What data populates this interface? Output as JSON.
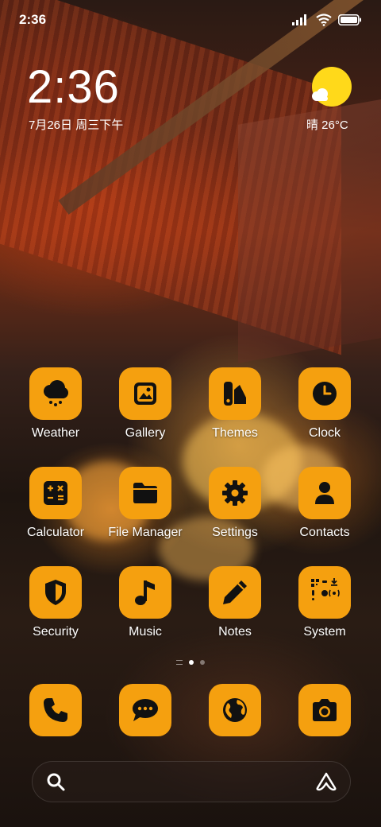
{
  "status_bar": {
    "time": "2:36"
  },
  "clock_widget": {
    "time": "2:36",
    "date": "7月26日 周三下午"
  },
  "weather_widget": {
    "text": "晴 26°C"
  },
  "apps": [
    {
      "label": "Weather",
      "icon": "cloud-rain-icon"
    },
    {
      "label": "Gallery",
      "icon": "image-icon"
    },
    {
      "label": "Themes",
      "icon": "theme-palette-icon"
    },
    {
      "label": "Clock",
      "icon": "clock-icon"
    },
    {
      "label": "Calculator",
      "icon": "calculator-icon"
    },
    {
      "label": "File Manager",
      "icon": "folder-icon"
    },
    {
      "label": "Settings",
      "icon": "gear-icon"
    },
    {
      "label": "Contacts",
      "icon": "person-icon"
    },
    {
      "label": "Security",
      "icon": "shield-icon"
    },
    {
      "label": "Music",
      "icon": "music-note-icon"
    },
    {
      "label": "Notes",
      "icon": "pencil-icon"
    },
    {
      "label": "System",
      "icon": "tools-grid-icon"
    }
  ],
  "dock": [
    {
      "icon": "phone-icon"
    },
    {
      "icon": "chat-bubble-icon"
    },
    {
      "icon": "globe-icon"
    },
    {
      "icon": "camera-icon"
    }
  ],
  "search_bar": {
    "left_icon": "search-icon",
    "right_icon": "assistant-icon"
  },
  "colors": {
    "tile": "#f5a00f",
    "glyph": "#111111",
    "sun": "#ffd91a"
  }
}
